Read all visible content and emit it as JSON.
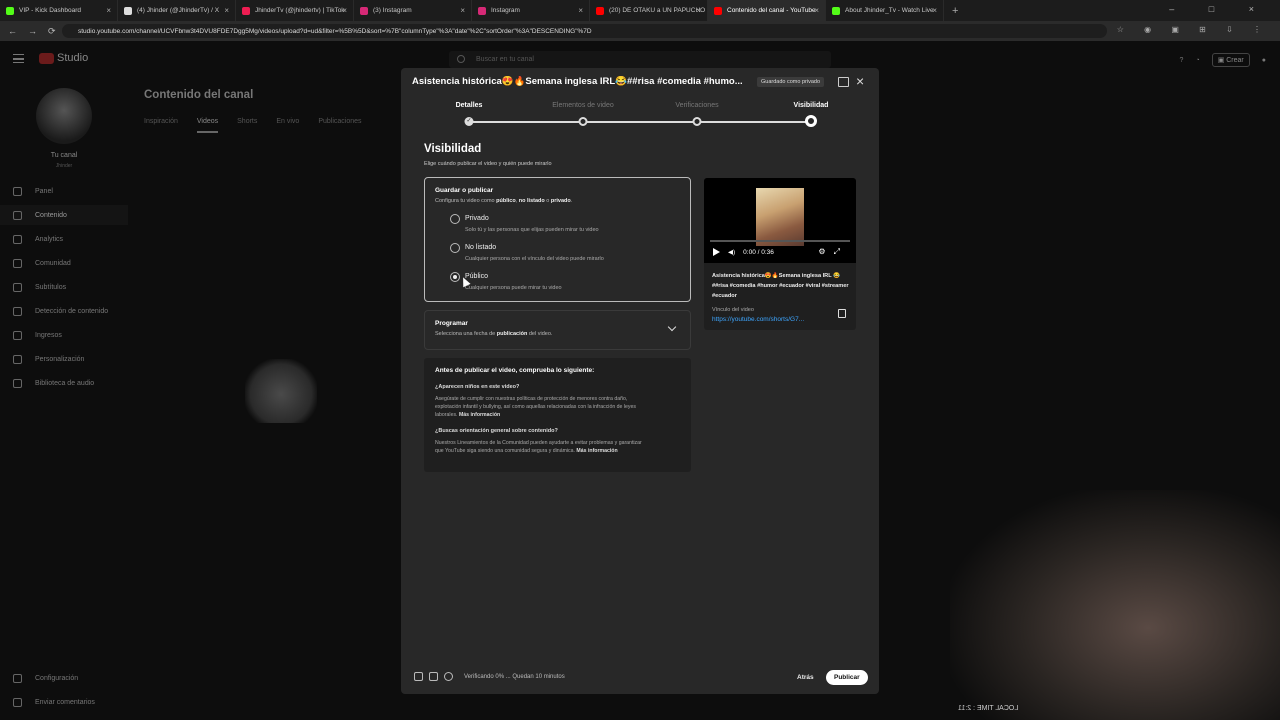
{
  "browser": {
    "tabs": [
      {
        "label": "VIP - Kick Dashboard",
        "color": "#53fc18"
      },
      {
        "label": "(4) Jhinder (@JhinderTv) / X",
        "color": "#dddddd"
      },
      {
        "label": "JhinderTv (@jhindertv) | TikTok",
        "color": "#ee1d52"
      },
      {
        "label": "(3) Instagram",
        "color": "#d62976"
      },
      {
        "label": "Instagram",
        "color": "#d62976"
      },
      {
        "label": "(20) DE OTAKU a UN PAPUCHO",
        "color": "#ff0000"
      },
      {
        "label": "Contenido del canal - YouTube",
        "color": "#ff0000"
      },
      {
        "label": "About Jhinder_Tv - Watch Live",
        "color": "#53fc18"
      }
    ],
    "new_tab": "+",
    "window_controls": "– □ ×",
    "nav": [
      "←",
      "→",
      "⟳"
    ],
    "url": "studio.youtube.com/channel/UCVFbnw3t4DVU8FDE7Dgg5Mg/videos/upload?d=ud&filter=%5B%5D&sort=%7B\"columnType\"%3A\"date\"%2C\"sortOrder\"%3A\"DESCENDING\"%7D",
    "extensions": "☆ ◉ ▣ ⊞ ⇩ ⋮"
  },
  "studio": {
    "logo": "Studio",
    "search_placeholder": "Buscar en tu canal",
    "crear": "Crear",
    "channel_label": "Tu canal",
    "channel_name": "Jhinder",
    "sidebar": [
      {
        "label": "Panel"
      },
      {
        "label": "Contenido"
      },
      {
        "label": "Analytics"
      },
      {
        "label": "Comunidad"
      },
      {
        "label": "Subtítulos"
      },
      {
        "label": "Detección de contenido"
      },
      {
        "label": "Ingresos"
      },
      {
        "label": "Personalización"
      },
      {
        "label": "Biblioteca de audio"
      }
    ],
    "sidebar_bottom": [
      {
        "label": "Configuración"
      },
      {
        "label": "Enviar comentarios"
      }
    ],
    "page_title": "Contenido del canal",
    "tabs": [
      "Inspiración",
      "Videos",
      "Shorts",
      "En vivo",
      "Publicaciones"
    ],
    "active_tab": "Videos",
    "overlay_text": "LOCAL TIME : 2:11"
  },
  "modal": {
    "title": "Asistencia histórica😍🔥Semana inglesa IRL😂##risa #comedia #humo...",
    "badge": "Guardado como privado",
    "steps": [
      "Detalles",
      "Elementos de video",
      "Verificaciones",
      "Visibilidad"
    ],
    "heading": "Visibilidad",
    "subheading": "Elige cuándo publicar el video y quién puede mirarlo",
    "save_box": {
      "title": "Guardar o publicar",
      "desc_pre": "Configura tu video como ",
      "desc_b1": "público",
      "desc_mid1": ", ",
      "desc_b2": "no listado",
      "desc_mid2": " o ",
      "desc_b3": "privado",
      "desc_end": ".",
      "options": [
        {
          "label": "Privado",
          "desc": "Solo tú y las personas que elijas pueden mirar tu video"
        },
        {
          "label": "No listado",
          "desc": "Cualquier persona con el vínculo del video puede mirarlo"
        },
        {
          "label": "Público",
          "desc": "Cualquier persona puede mirar tu video"
        }
      ],
      "selected": "Público"
    },
    "schedule": {
      "title": "Programar",
      "desc_pre": "Selecciona una fecha de ",
      "desc_b": "publicación",
      "desc_end": " del video."
    },
    "checklist": {
      "title": "Antes de publicar el video, comprueba lo siguiente:",
      "q1": "¿Aparecen niños en este video?",
      "p1": "Asegúrate de cumplir con nuestras políticas de protección de menores contra daño, explotación infantil y bullying, así como aquellas relacionadas con la infracción de leyes laborales.",
      "p1_link": "Más información",
      "q2": "¿Buscas orientación general sobre contenido?",
      "p2": "Nuestros Lineamientos de la Comunidad pueden ayudarte a evitar problemas y garantizar que YouTube siga siendo una comunidad segura y dinámica.",
      "p2_link": "Más información"
    },
    "preview": {
      "time": "0:00 / 0:36",
      "title": "Asistencia histórica😍🔥Semana inglesa IRL 😂##risa #comedia #humor #ecuador #viral #streamer #ecuador",
      "link_label": "Vínculo del video",
      "link": "https://youtube.com/shorts/G7..."
    },
    "footer": {
      "status": "Verificando 0% ... Quedan 10 minutos",
      "back": "Atrás",
      "publish": "Publicar"
    }
  }
}
